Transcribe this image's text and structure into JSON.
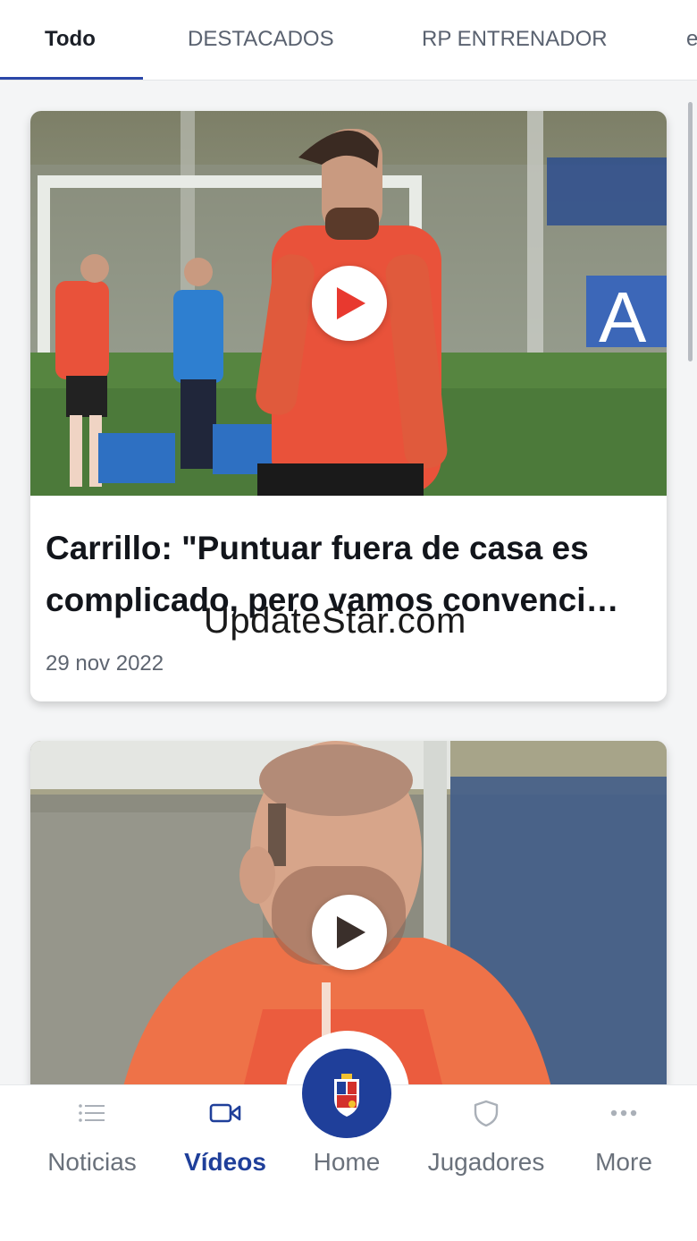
{
  "tabs": [
    {
      "label": "Todo"
    },
    {
      "label": "DESTACADOS"
    },
    {
      "label": "RP ENTRENADOR"
    },
    {
      "label": "e"
    }
  ],
  "articles": [
    {
      "title_line1": "Carrillo: \"Puntuar fuera de casa es",
      "title_line2": "complicado, pero vamos convenci…",
      "date": "29 nov 2022"
    },
    {
      "title_line1": "",
      "title_line2": "",
      "date": ""
    }
  ],
  "watermark": "UpdateStar.com",
  "bottom_nav": {
    "items": [
      {
        "label": "Noticias",
        "icon": "list-icon"
      },
      {
        "label": "Vídeos",
        "icon": "video-camera-icon",
        "active": true
      },
      {
        "label": "Home",
        "icon": "club-crest-icon"
      },
      {
        "label": "Jugadores",
        "icon": "shield-icon"
      },
      {
        "label": "More",
        "icon": "more-dots-icon"
      }
    ]
  },
  "colors": {
    "accent": "#1f3f9a",
    "tab_indicator": "#2a47a8",
    "play_triangle_1": "#e8392f",
    "play_triangle_2": "#3a2f2b",
    "jersey": "#e9523a"
  }
}
